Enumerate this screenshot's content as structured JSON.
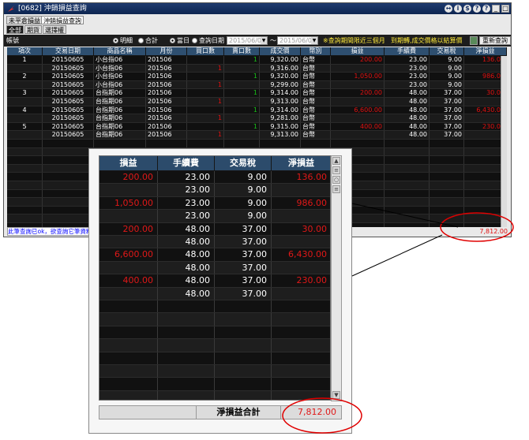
{
  "window": {
    "title": "[0682] 沖銷損益查詢",
    "title_buttons": [
      "↔",
      "i",
      "$",
      "?",
      "?"
    ],
    "min": "_",
    "max": "□",
    "close": "X"
  },
  "tabs_top": [
    "未平倉損益",
    "沖銷損益查詢"
  ],
  "tabs_sub": [
    "全部",
    "期貨",
    "選擇權"
  ],
  "filter": {
    "label": "帳號",
    "opt_detail": "明細",
    "opt_total": "合計",
    "opt_today": "當日",
    "opt_range": "查詢日期",
    "date_from": "2015/06/05",
    "tilde": "～",
    "date_to": "2015/06/05",
    "note1": "※查詢期間限近三個月",
    "note2": "到期轉,成交價格以結算價",
    "refresh": "重新查詢"
  },
  "grid": {
    "headers": [
      "項次",
      "交易日期",
      "商品名稱",
      "月份",
      "買口數",
      "賣口數",
      "成交價",
      "幣別",
      "損益",
      "手續費",
      "交易稅",
      "淨損益"
    ],
    "rows": [
      [
        "1",
        "20150605",
        "小台指06",
        "201506",
        "",
        "1",
        "9,320.00",
        "台幣",
        "200.00",
        "23.00",
        "9.00",
        "136.00"
      ],
      [
        "",
        "20150605",
        "小台指06",
        "201506",
        "1",
        "",
        "9,316.00",
        "台幣",
        "",
        "23.00",
        "9.00",
        ""
      ],
      [
        "2",
        "20150605",
        "小台指06",
        "201506",
        "",
        "1",
        "9,320.00",
        "台幣",
        "1,050.00",
        "23.00",
        "9.00",
        "986.00"
      ],
      [
        "",
        "20150605",
        "小台指06",
        "201506",
        "1",
        "",
        "9,299.00",
        "台幣",
        "",
        "23.00",
        "9.00",
        ""
      ],
      [
        "3",
        "20150605",
        "台指期06",
        "201506",
        "",
        "1",
        "9,314.00",
        "台幣",
        "200.00",
        "48.00",
        "37.00",
        "30.00"
      ],
      [
        "",
        "20150605",
        "台指期06",
        "201506",
        "1",
        "",
        "9,313.00",
        "台幣",
        "",
        "48.00",
        "37.00",
        ""
      ],
      [
        "4",
        "20150605",
        "台指期06",
        "201506",
        "",
        "1",
        "9,314.00",
        "台幣",
        "6,600.00",
        "48.00",
        "37.00",
        "6,430.00"
      ],
      [
        "",
        "20150605",
        "台指期06",
        "201506",
        "1",
        "",
        "9,281.00",
        "台幣",
        "",
        "48.00",
        "37.00",
        ""
      ],
      [
        "5",
        "20150605",
        "台指期06",
        "201506",
        "",
        "1",
        "9,315.00",
        "台幣",
        "400.00",
        "48.00",
        "37.00",
        "230.00"
      ],
      [
        "",
        "20150605",
        "台指期06",
        "201506",
        "1",
        "",
        "9,313.00",
        "台幣",
        "",
        "48.00",
        "37.00",
        ""
      ]
    ]
  },
  "status_text": "此筆查詢已ok，欲查詢它筆資料，",
  "total_value": "7,812.00",
  "zoom": {
    "headers": [
      "損益",
      "手續費",
      "交易稅",
      "淨損益"
    ],
    "rows": [
      [
        "200.00",
        "23.00",
        "9.00",
        "136.00"
      ],
      [
        "",
        "23.00",
        "9.00",
        ""
      ],
      [
        "1,050.00",
        "23.00",
        "9.00",
        "986.00"
      ],
      [
        "",
        "23.00",
        "9.00",
        ""
      ],
      [
        "200.00",
        "48.00",
        "37.00",
        "30.00"
      ],
      [
        "",
        "48.00",
        "37.00",
        ""
      ],
      [
        "6,600.00",
        "48.00",
        "37.00",
        "6,430.00"
      ],
      [
        "",
        "48.00",
        "37.00",
        ""
      ],
      [
        "400.00",
        "48.00",
        "37.00",
        "230.00"
      ],
      [
        "",
        "48.00",
        "37.00",
        ""
      ]
    ],
    "total_label": "淨損益合計",
    "total_value": "7,812.00"
  },
  "colors": {
    "loss_profit": "#e01010",
    "sell": "#18c018",
    "header": "#2e4f70",
    "grid_bg": "#141414",
    "annotation": "#e00000"
  }
}
